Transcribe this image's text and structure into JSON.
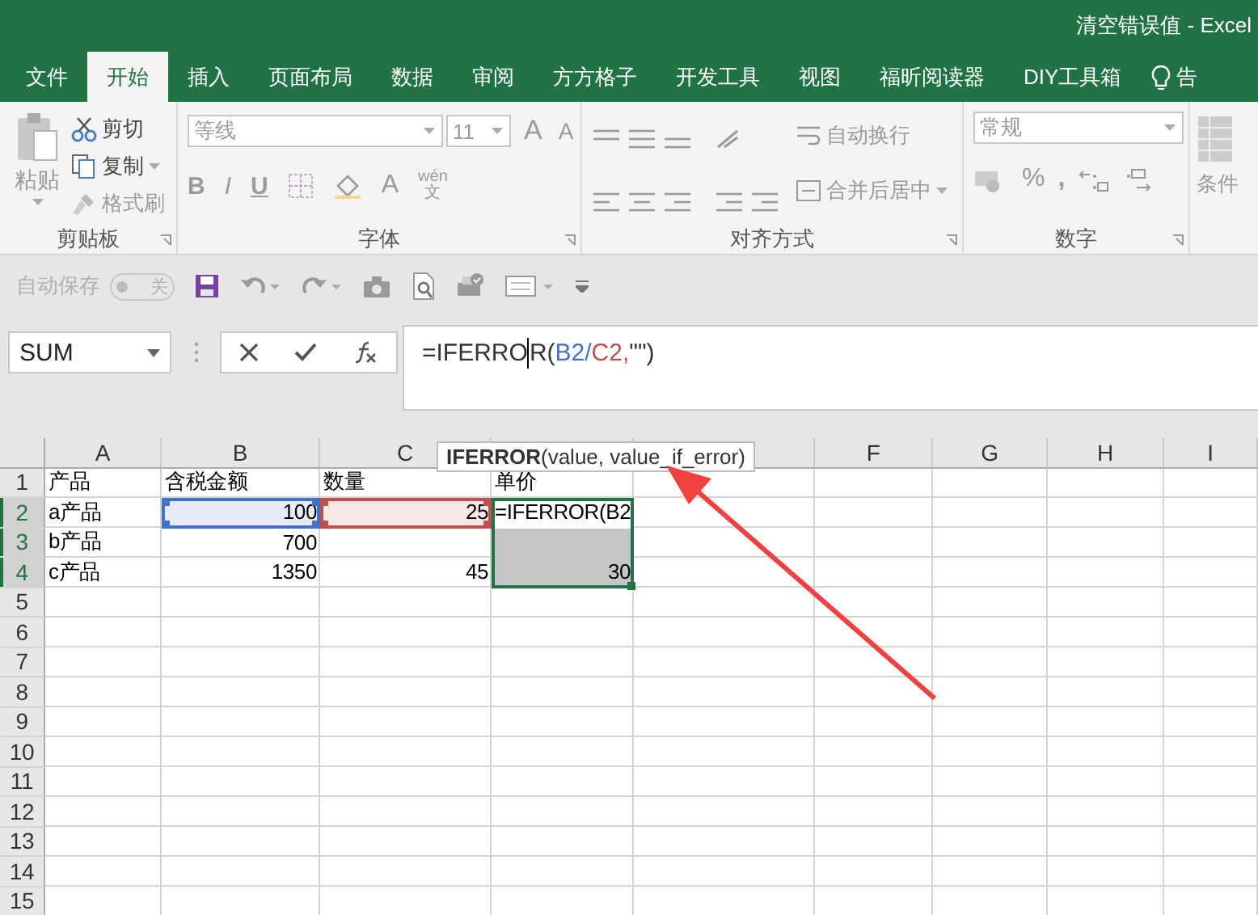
{
  "window": {
    "title": "清空错误值 - Excel"
  },
  "tabs": [
    {
      "label": "文件",
      "selected": false
    },
    {
      "label": "开始",
      "selected": true
    },
    {
      "label": "插入",
      "selected": false
    },
    {
      "label": "页面布局",
      "selected": false
    },
    {
      "label": "数据",
      "selected": false
    },
    {
      "label": "审阅",
      "selected": false
    },
    {
      "label": "方方格子",
      "selected": false
    },
    {
      "label": "开发工具",
      "selected": false
    },
    {
      "label": "视图",
      "selected": false
    },
    {
      "label": "福昕阅读器",
      "selected": false
    },
    {
      "label": "DIY工具箱",
      "selected": false
    },
    {
      "label": "告",
      "selected": false
    }
  ],
  "ribbon": {
    "clipboard": {
      "label": "剪贴板",
      "paste": "粘贴",
      "cut": "剪切",
      "copy": "复制",
      "format_painter": "格式刷"
    },
    "font": {
      "label": "字体",
      "font_name": "等线",
      "font_size": "11",
      "grow": "A",
      "shrink": "A",
      "bold": "B",
      "italic": "I",
      "underline": "U",
      "font_color": "A",
      "phonetic": "wén",
      "phonetic_char": "文"
    },
    "alignment": {
      "label": "对齐方式",
      "wrap_text": "自动换行",
      "merge_center": "合并后居中"
    },
    "number": {
      "label": "数字",
      "format": "常规",
      "percent": "%",
      "comma": ","
    },
    "styles": {
      "label": "条件"
    }
  },
  "quick_access": {
    "autosave": "自动保存",
    "autosave_toggle": "关",
    "autosave_on": false
  },
  "formula_bar": {
    "name_box": "SUM",
    "parts": [
      {
        "kind": "text",
        "text": "=IFERRO",
        "color": "#333333"
      },
      {
        "kind": "cursor"
      },
      {
        "kind": "text",
        "text": "R(",
        "color": "#333333"
      },
      {
        "kind": "text",
        "text": "B2/",
        "color": "#4472c4"
      },
      {
        "kind": "text",
        "text": "C2,",
        "color": "#c0504d"
      },
      {
        "kind": "text",
        "text": "\"\")",
        "color": "#333333"
      }
    ]
  },
  "tooltip": {
    "function": "IFERROR",
    "args": "(value, value_if_error)"
  },
  "sheet": {
    "columns": [
      {
        "kind": "header",
        "label": "A"
      },
      {
        "kind": "header",
        "label": "B"
      },
      {
        "kind": "header",
        "label": "C"
      },
      {
        "kind": "covered"
      },
      {
        "kind": "covered"
      },
      {
        "kind": "header",
        "label": "F"
      },
      {
        "kind": "header",
        "label": "G"
      },
      {
        "kind": "header",
        "label": "H"
      },
      {
        "kind": "header",
        "label": "I"
      }
    ],
    "rows": [
      {
        "label": "1",
        "selected": false,
        "cells": [
          {
            "kind": "text",
            "text": "产品",
            "selected": false
          },
          {
            "kind": "text",
            "text": "含税金额",
            "selected": false
          },
          {
            "kind": "text",
            "text": "数量",
            "selected": false
          },
          {
            "kind": "text",
            "text": "单价",
            "selected": false
          }
        ]
      },
      {
        "label": "2",
        "selected": true,
        "cells": [
          {
            "kind": "text",
            "text": "a产品",
            "selected": false
          },
          {
            "kind": "number",
            "text": "100",
            "selected": false,
            "color": "#4472c4"
          },
          {
            "kind": "number",
            "text": "25",
            "selected": false,
            "color": "#c0504d"
          },
          {
            "kind": "text",
            "text": "=IFERROR(B2",
            "selected": true
          }
        ]
      },
      {
        "label": "3",
        "selected": true,
        "cells": [
          {
            "kind": "text",
            "text": "b产品",
            "selected": false
          },
          {
            "kind": "number",
            "text": "700",
            "selected": false
          },
          {
            "kind": "empty",
            "selected": false
          },
          {
            "kind": "empty",
            "selected": true
          }
        ]
      },
      {
        "label": "4",
        "selected": true,
        "cells": [
          {
            "kind": "text",
            "text": "c产品",
            "selected": false
          },
          {
            "kind": "number",
            "text": "1350",
            "selected": false
          },
          {
            "kind": "number",
            "text": "45",
            "selected": false
          },
          {
            "kind": "number",
            "text": "30",
            "selected": true
          }
        ]
      },
      {
        "label": "5",
        "selected": false
      },
      {
        "label": "6",
        "selected": false
      },
      {
        "label": "7",
        "selected": false
      },
      {
        "label": "8",
        "selected": false
      },
      {
        "label": "9",
        "selected": false
      },
      {
        "label": "10",
        "selected": false
      },
      {
        "label": "11",
        "selected": false
      },
      {
        "label": "12",
        "selected": false
      },
      {
        "label": "13",
        "selected": false
      },
      {
        "label": "14",
        "selected": false
      },
      {
        "label": "15",
        "selected": false
      }
    ]
  }
}
